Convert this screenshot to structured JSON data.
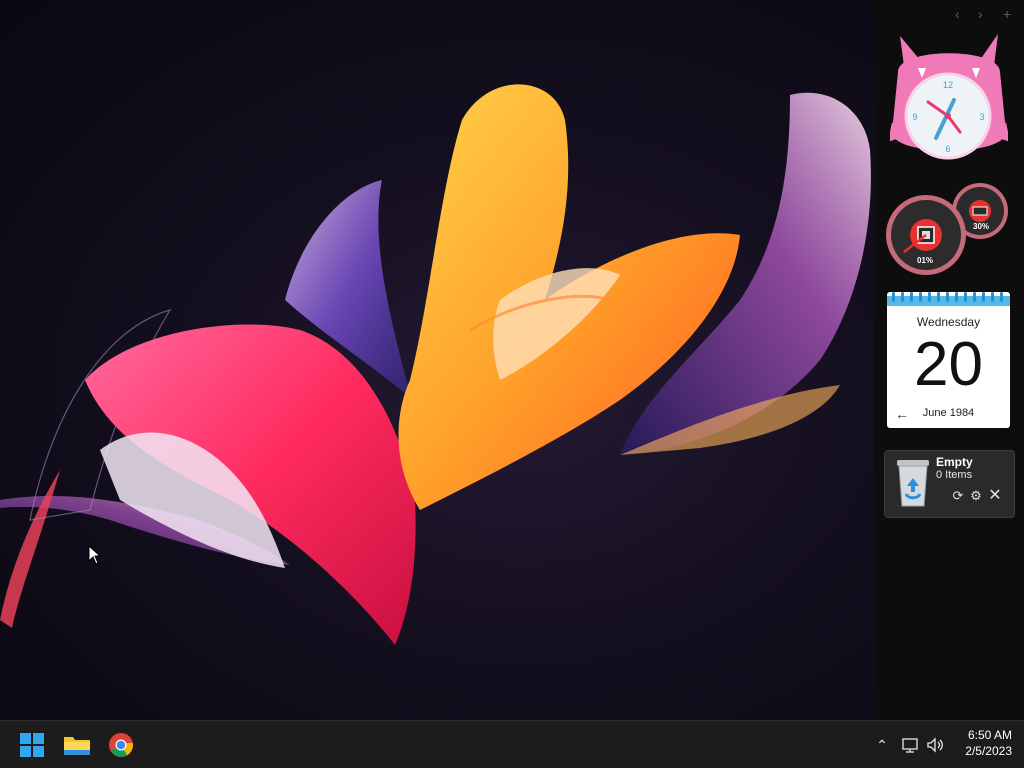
{
  "widget_panel": {
    "nav": {
      "prev_icon": "chevron-left-icon",
      "next_icon": "chevron-right-icon",
      "add_icon": "plus-icon"
    },
    "clock": {
      "numerals": {
        "twelve": "12",
        "three": "3",
        "six": "6",
        "nine": "9"
      }
    },
    "meters": {
      "cpu_percent": "01%",
      "ram_percent": "30%"
    },
    "calendar": {
      "weekday": "Wednesday",
      "day": "20",
      "month_year": "June 1984",
      "back_icon": "arrow-left-icon"
    },
    "recycle_bin": {
      "status": "Empty",
      "count": "0 Items",
      "icon": "recycle-bin-icon",
      "actions": [
        "refresh-icon",
        "gear-icon",
        "close-icon"
      ]
    }
  },
  "taskbar": {
    "apps": [
      {
        "name": "Start",
        "icon": "windows-logo-icon"
      },
      {
        "name": "File Explorer",
        "icon": "folder-icon"
      },
      {
        "name": "Google Chrome",
        "icon": "chrome-icon"
      }
    ],
    "tray": {
      "icons": [
        "chevron-up-icon",
        "network-icon",
        "volume-icon"
      ],
      "time": "6:50 AM",
      "date": "2/5/2023"
    }
  },
  "colors": {
    "windows_blue": "#2fa8f0",
    "folder_yellow": "#f4c430",
    "taskbar_bg": "#1c1c1c",
    "panel_bg": "#0d0d0d",
    "clock_pink": "#f07ab8",
    "meter_red": "#e8312f"
  }
}
